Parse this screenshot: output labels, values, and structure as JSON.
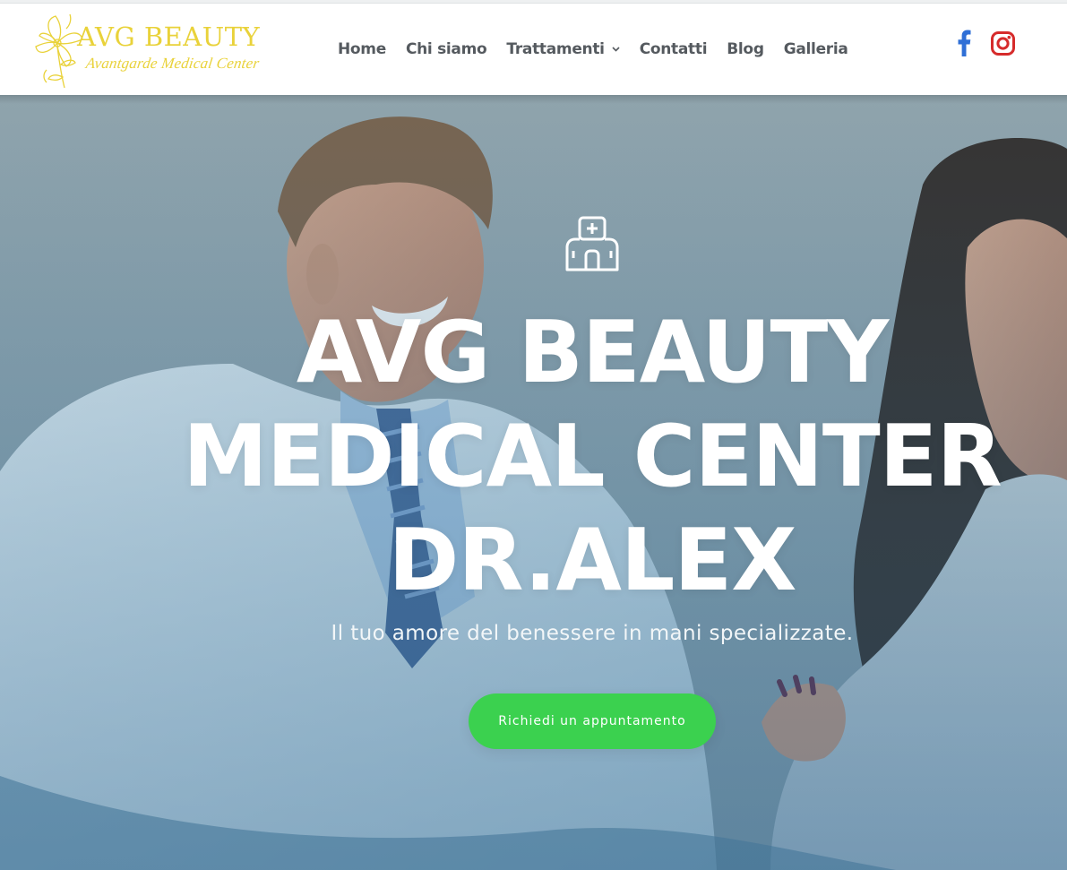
{
  "brand": {
    "name": "AVG BEAUTY",
    "tagline": "Avantgarde Medical Center",
    "logo_icon": "flower-icon",
    "color": "#e9d23a"
  },
  "nav": {
    "items": [
      {
        "label": "Home"
      },
      {
        "label": "Chi siamo"
      },
      {
        "label": "Trattamenti",
        "has_dropdown": true,
        "dropdown_icon": "chevron-down-icon"
      },
      {
        "label": "Contatti"
      },
      {
        "label": "Blog"
      },
      {
        "label": "Galleria"
      }
    ],
    "color": "#555a5f"
  },
  "social": {
    "facebook_icon": "facebook-icon",
    "instagram_icon": "instagram-icon",
    "facebook_color": "#2f6fd6",
    "instagram_color": "#d62b2b"
  },
  "hero": {
    "icon": "hospital-icon",
    "title_lines": [
      "AVG BEAUTY",
      "MEDICAL CENTER",
      "DR.ALEX"
    ],
    "subtitle": "Il tuo amore del benessere in mani specializzate.",
    "cta_label": "Richiedi un appuntamento",
    "cta_color": "#3bd14f"
  }
}
